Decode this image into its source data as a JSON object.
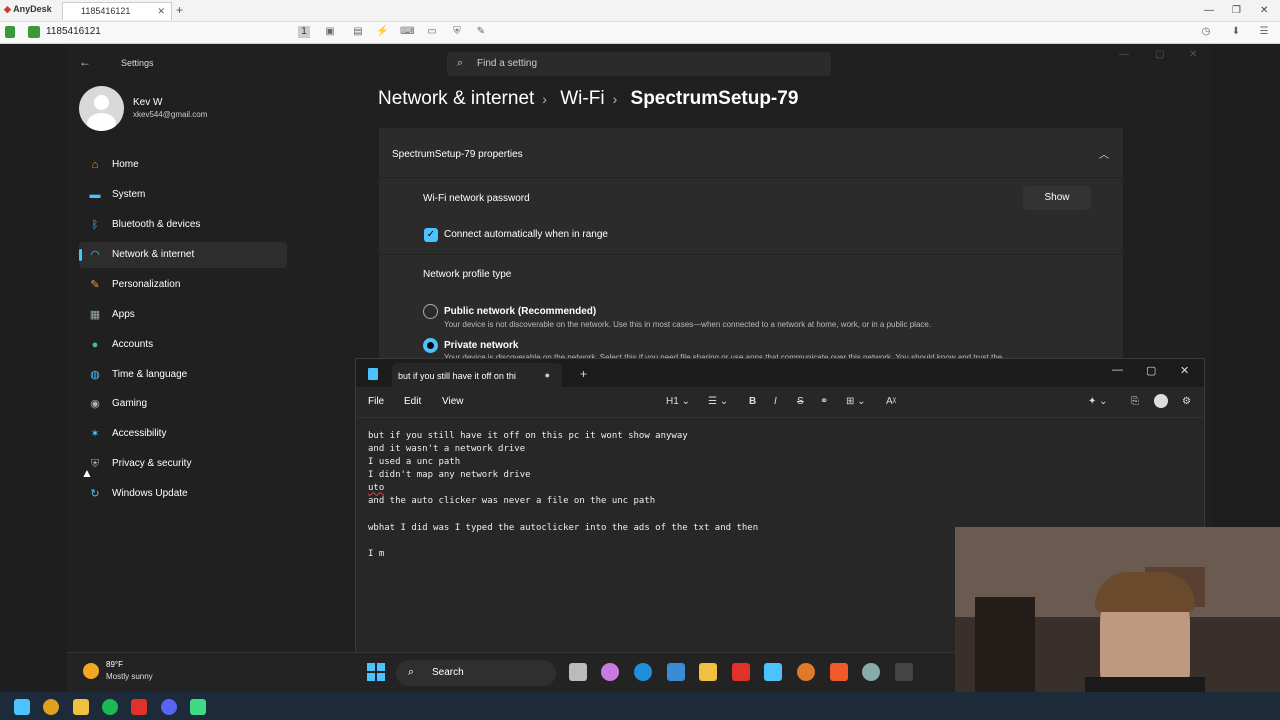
{
  "anydesk": {
    "brand": "AnyDesk",
    "tab_label": "1185416121",
    "address": "1185416121"
  },
  "settings": {
    "window_title": "Settings",
    "search_placeholder": "Find a setting",
    "user": {
      "name": "Kev W",
      "email": "xkev544@gmail.com"
    },
    "nav": [
      {
        "label": "Home",
        "icon": "home-icon"
      },
      {
        "label": "System",
        "icon": "monitor-icon"
      },
      {
        "label": "Bluetooth & devices",
        "icon": "bluetooth-icon"
      },
      {
        "label": "Network & internet",
        "icon": "wifi-icon",
        "selected": true
      },
      {
        "label": "Personalization",
        "icon": "brush-icon"
      },
      {
        "label": "Apps",
        "icon": "apps-icon"
      },
      {
        "label": "Accounts",
        "icon": "person-icon"
      },
      {
        "label": "Time & language",
        "icon": "globe-icon"
      },
      {
        "label": "Gaming",
        "icon": "gamepad-icon"
      },
      {
        "label": "Accessibility",
        "icon": "accessibility-icon"
      },
      {
        "label": "Privacy & security",
        "icon": "shield-icon"
      },
      {
        "label": "Windows Update",
        "icon": "update-icon"
      }
    ],
    "breadcrumb": [
      "Network & internet",
      "Wi-Fi",
      "SpectrumSetup-79"
    ],
    "properties_header": "SpectrumSetup-79 properties",
    "password_label": "Wi-Fi network password",
    "show_button": "Show",
    "auto_connect": {
      "label": "Connect automatically when in range",
      "checked": true
    },
    "profile_type_label": "Network profile type",
    "public": {
      "label": "Public network (Recommended)",
      "desc": "Your device is not discoverable on the network. Use this in most cases—when connected to a network at home, work, or in a public place."
    },
    "private": {
      "label": "Private network",
      "desc": "Your device is discoverable on the network. Select this if you need file sharing or use apps that communicate over this network. You should know and trust the"
    }
  },
  "notepad": {
    "tab_title": "but if you still have it off on thi",
    "menu": [
      "File",
      "Edit",
      "View"
    ],
    "heading_select": "H1",
    "lines": [
      "but if you still have it off on this pc it wont show anyway",
      "and it wasn't a network drive",
      "I used a unc path",
      "I didn't map any network drive",
      "uto",
      "and the auto clicker was never a file on the unc path",
      "",
      "wbhat I did was I typed the autoclicker into the ads of the txt and then",
      "",
      "I m"
    ]
  },
  "taskbar": {
    "temp": "89°F",
    "condition": "Mostly sunny",
    "search_label": "Search"
  },
  "colors": {
    "accent": "#4cc2ff",
    "bg": "#202020",
    "panel": "#2b2b2b"
  }
}
